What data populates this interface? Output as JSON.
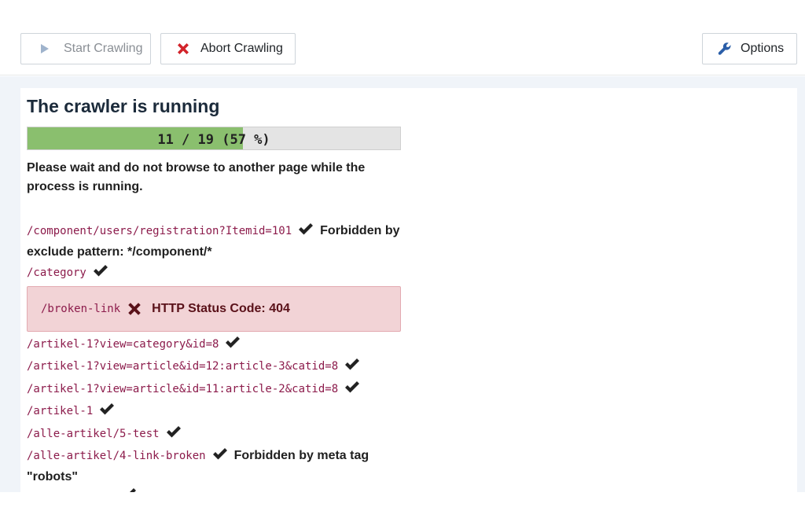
{
  "toolbar": {
    "start_label": "Start Crawling",
    "abort_label": "Abort Crawling",
    "options_label": "Options"
  },
  "status": {
    "title": "The crawler is running",
    "progress_text": "11 / 19 (57 %)",
    "progress_fraction": 0.579,
    "wait_message": "Please wait and do not browse to another page while the process is running."
  },
  "log": [
    {
      "url": "/component/users/registration?Itemid=101",
      "status": "ok",
      "message": "Forbidden by exclude pattern: */component/*"
    },
    {
      "url": "/category",
      "status": "ok",
      "message": ""
    },
    {
      "url": "/broken-link",
      "status": "error",
      "message": "HTTP Status Code: 404"
    },
    {
      "url": "/artikel-1?view=category&id=8",
      "status": "ok",
      "message": ""
    },
    {
      "url": "/artikel-1?view=article&id=12:article-3&catid=8",
      "status": "ok",
      "message": ""
    },
    {
      "url": "/artikel-1?view=article&id=11:article-2&catid=8",
      "status": "ok",
      "message": ""
    },
    {
      "url": "/artikel-1",
      "status": "ok",
      "message": ""
    },
    {
      "url": "/alle-artikel/5-test",
      "status": "ok",
      "message": ""
    },
    {
      "url": "/alle-artikel/4-link-broken",
      "status": "ok",
      "message": "Forbidden by meta tag \"robots\""
    }
  ],
  "colors": {
    "progress_fill": "#8abf6e",
    "error_bg": "#f2d3d6",
    "url_text": "#8c1b4b",
    "abort_icon": "#d2232a",
    "options_icon": "#2a5ea8"
  }
}
